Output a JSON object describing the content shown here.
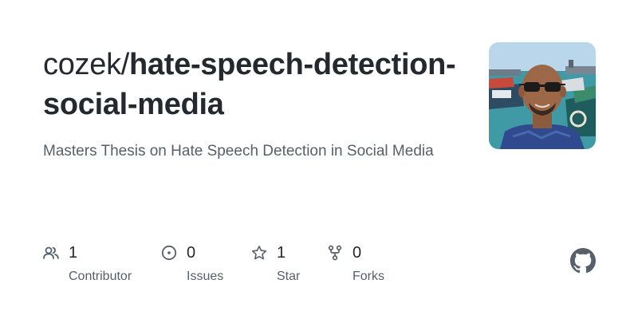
{
  "repo": {
    "owner": "cozek/",
    "name": "hate-speech-detection-social-media",
    "description": "Masters Thesis on Hate Speech Detection in Social Media"
  },
  "avatar": {
    "icon": "user-avatar-photo"
  },
  "stats": [
    {
      "icon": "people-icon",
      "count": "1",
      "label": "Contributor"
    },
    {
      "icon": "issue-icon",
      "count": "0",
      "label": "Issues"
    },
    {
      "icon": "star-icon",
      "count": "1",
      "label": "Star"
    },
    {
      "icon": "fork-icon",
      "count": "0",
      "label": "Forks"
    }
  ],
  "brand": {
    "icon": "github-logo-icon"
  },
  "colors": {
    "text": "#24292f",
    "muted": "#57606a",
    "icon": "#57606a"
  }
}
